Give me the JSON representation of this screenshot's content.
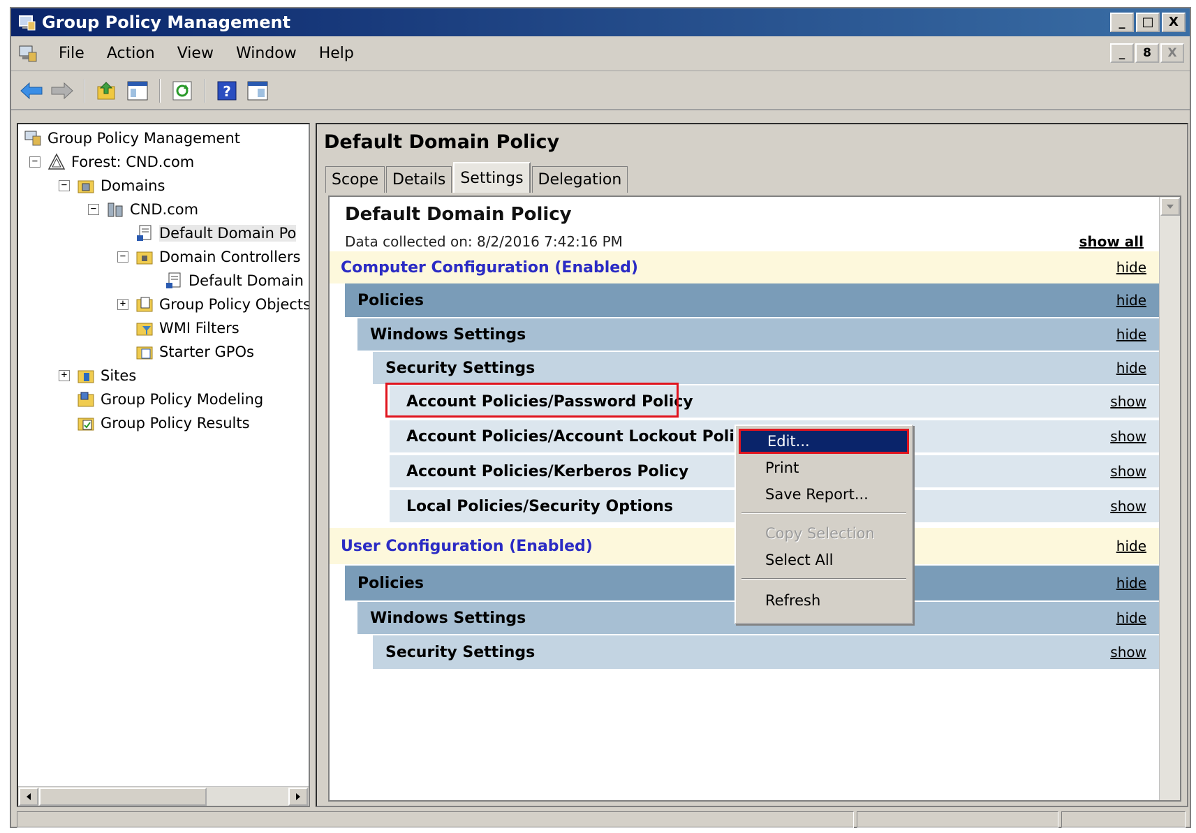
{
  "window": {
    "title": "Group Policy Management",
    "caption_buttons": [
      "_",
      "□",
      "X"
    ]
  },
  "menubar": {
    "items": [
      "File",
      "Action",
      "View",
      "Window",
      "Help"
    ],
    "mdi_buttons": [
      "_",
      "8",
      "X"
    ]
  },
  "toolbar": {
    "icons": [
      "back-arrow-icon",
      "forward-arrow-icon",
      "up-folder-icon",
      "show-hide-tree-icon",
      "refresh-icon",
      "help-icon",
      "console-view-icon"
    ]
  },
  "tree": {
    "root": "Group Policy Management",
    "forest": "Forest: CND.com",
    "domains": "Domains",
    "domain": "CND.com",
    "default_domain_policy": "Default Domain Po",
    "domain_controllers": "Domain Controllers",
    "default_domain_controllers": "Default Domain",
    "gpo_container": "Group Policy Objects",
    "wmi_filters": "WMI Filters",
    "starter_gpos": "Starter GPOs",
    "sites": "Sites",
    "modeling": "Group Policy Modeling",
    "results": "Group Policy Results",
    "expand_minus": "−",
    "expand_plus": "+"
  },
  "rightpane": {
    "title": "Default Domain Policy",
    "tabs": [
      "Scope",
      "Details",
      "Settings",
      "Delegation"
    ],
    "active_tab": "Settings"
  },
  "report": {
    "title": "Default Domain Policy",
    "collected": "Data collected on: 8/2/2016 7:42:16 PM",
    "show_all": "show all",
    "computer_config": {
      "label": "Computer Configuration (Enabled)",
      "link": "hide"
    },
    "c_policies": {
      "label": "Policies",
      "link": "hide"
    },
    "c_windows": {
      "label": "Windows Settings",
      "link": "hide"
    },
    "c_security": {
      "label": "Security Settings",
      "link": "hide"
    },
    "c_items": [
      {
        "label": "Account Policies/Password Policy",
        "link": "show"
      },
      {
        "label": "Account Policies/Account Lockout Policy",
        "link": "show"
      },
      {
        "label": "Account Policies/Kerberos Policy",
        "link": "show"
      },
      {
        "label": "Local Policies/Security Options",
        "link": "show"
      }
    ],
    "user_config": {
      "label": "User Configuration (Enabled)",
      "link": "hide"
    },
    "u_policies": {
      "label": "Policies",
      "link": "hide"
    },
    "u_windows": {
      "label": "Windows Settings",
      "link": "hide"
    },
    "u_security": {
      "label": "Security Settings",
      "link": "show"
    }
  },
  "context_menu": {
    "items": [
      "Edit...",
      "Print",
      "Save Report...",
      "Copy Selection",
      "Select All",
      "Refresh"
    ]
  },
  "colors": {
    "title_bar": "#0a246a",
    "highlight_border": "#e0141e",
    "config_band": "#fdf8dc",
    "config_text": "#2b2bc4",
    "policies_band": "#7a9cb8",
    "windows_band": "#a7bfd3",
    "security_band": "#c3d4e2",
    "item_band": "#dce6ee"
  }
}
